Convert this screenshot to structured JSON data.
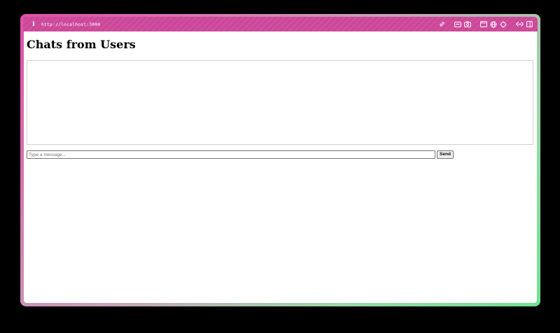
{
  "browser": {
    "url": "http://localhost:3000",
    "icons": {
      "info": "info-icon",
      "link": "link-icon",
      "media": "media-icon",
      "camera": "camera-icon",
      "window": "window-icon",
      "globe": "globe-icon",
      "target": "target-icon",
      "code": "code-icon",
      "sidebar": "sidebar-icon"
    },
    "accent_color": "#cc4799"
  },
  "page": {
    "title": "Chats from Users",
    "chat_messages": [],
    "message_input": {
      "value": "",
      "placeholder": "Type a message..."
    },
    "send_label": "Send"
  }
}
